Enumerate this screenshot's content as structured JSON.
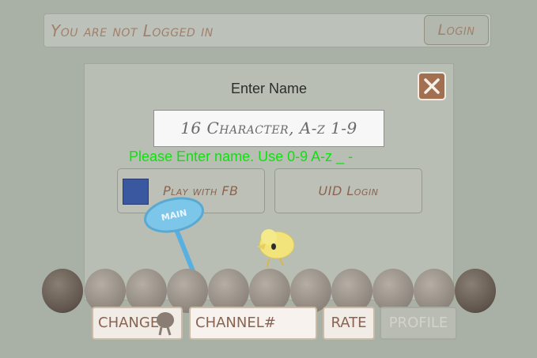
{
  "top_bar": {
    "status_text": "You are not Logged in",
    "login_label": "Login"
  },
  "dialog": {
    "title": "Enter Name",
    "name_input_placeholder": "16 Character, A-z 1-9",
    "hint": "Please Enter name. Use 0-9 A-z _ -",
    "fb_button_label": "Play with FB",
    "uid_button_label": "UID Login",
    "close_icon": "close-x-icon"
  },
  "scene": {
    "signpost_label": "MAIN"
  },
  "bottom_bar": {
    "change_label": "CHANGE",
    "channel_placeholder": "CHANNEL#",
    "rate_label": "RATE",
    "profile_label": "PROFILE"
  },
  "colors": {
    "background": "#a9b0a6",
    "accent_brown": "#8a6450",
    "hint_green": "#10e010",
    "fb_blue": "#3a58a0",
    "close_button": "#a27050"
  }
}
